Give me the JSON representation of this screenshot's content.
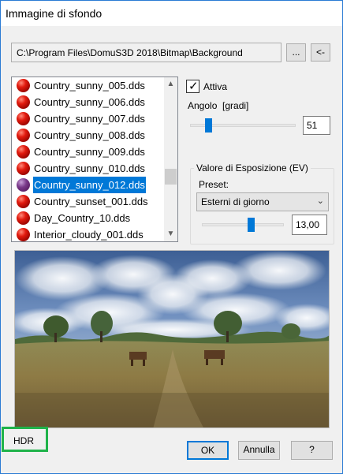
{
  "window": {
    "title": "Immagine di sfondo"
  },
  "path": {
    "value": "C:\\Program Files\\DomuS3D 2018\\Bitmap\\Background"
  },
  "buttons": {
    "browse": "...",
    "back": "<-",
    "ok": "OK",
    "cancel": "Annulla",
    "help": "?"
  },
  "file_list": {
    "items": [
      "Country_sunny_005.dds",
      "Country_sunny_006.dds",
      "Country_sunny_007.dds",
      "Country_sunny_008.dds",
      "Country_sunny_009.dds",
      "Country_sunny_010.dds",
      "Country_sunny_012.dds",
      "Country_sunset_001.dds",
      "Day_Country_10.dds",
      "Interior_cloudy_001.dds"
    ],
    "selected_index": 6
  },
  "active": {
    "label": "Attiva",
    "checked": true
  },
  "angle": {
    "label": "Angolo  [gradi]",
    "value": "51"
  },
  "exposure": {
    "group_label": "Valore di Esposizione (EV)",
    "preset_label": "Preset:",
    "preset_value": "Esterni di giorno",
    "value": "13,00"
  },
  "hdr_label": "HDR",
  "icons": {
    "file": "red-sphere-icon",
    "dropdown": "chevron-down-icon",
    "scroll_up": "chevron-up-icon",
    "scroll_down": "chevron-down-icon"
  }
}
